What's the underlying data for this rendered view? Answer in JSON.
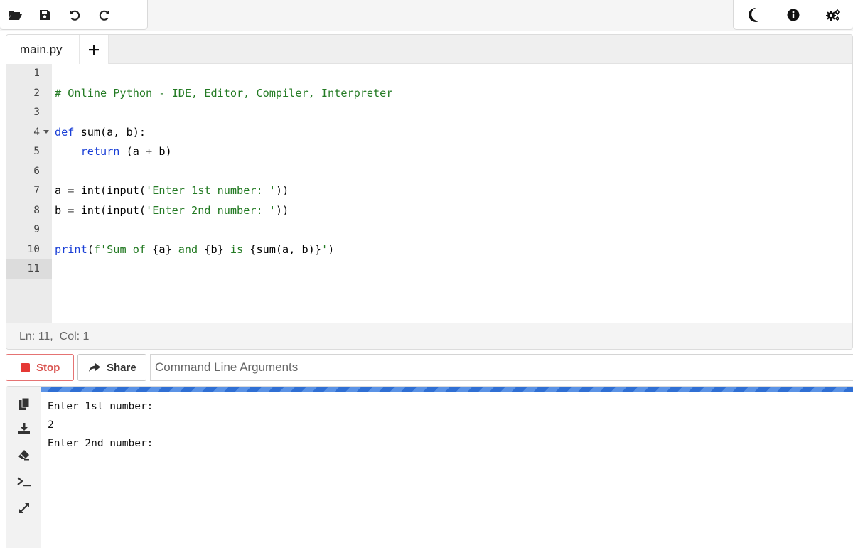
{
  "toolbar": {
    "left_icons": [
      "open-folder-icon",
      "save-icon",
      "undo-icon",
      "redo-icon"
    ],
    "right_icons": [
      "dark-mode-moon-icon",
      "info-icon",
      "settings-gears-icon"
    ]
  },
  "editor": {
    "tabs": [
      {
        "label": "main.py",
        "active": true
      }
    ],
    "add_tab_icon": "plus-icon",
    "line_numbers": [
      "1",
      "2",
      "3",
      "4",
      "5",
      "6",
      "7",
      "8",
      "9",
      "10",
      "11"
    ],
    "foldable_line": "4",
    "active_line": "11",
    "code_lines": [
      {
        "line": "1",
        "tokens": []
      },
      {
        "line": "2",
        "tokens": [
          {
            "t": "# Online Python - IDE, Editor, Compiler, Interpreter",
            "k": "comment"
          }
        ]
      },
      {
        "line": "3",
        "tokens": []
      },
      {
        "line": "4",
        "tokens": [
          {
            "t": "def",
            "k": "kw"
          },
          {
            "t": " sum(a, b):",
            "k": "plain"
          }
        ]
      },
      {
        "line": "5",
        "tokens": [
          {
            "t": "    ",
            "k": "plain"
          },
          {
            "t": "return",
            "k": "kw"
          },
          {
            "t": " (a ",
            "k": "plain"
          },
          {
            "t": "+",
            "k": "op"
          },
          {
            "t": " b)",
            "k": "plain"
          }
        ]
      },
      {
        "line": "6",
        "tokens": []
      },
      {
        "line": "7",
        "tokens": [
          {
            "t": "a ",
            "k": "plain"
          },
          {
            "t": "=",
            "k": "op"
          },
          {
            "t": " int(input(",
            "k": "plain"
          },
          {
            "t": "'Enter 1st number: '",
            "k": "str"
          },
          {
            "t": "))",
            "k": "plain"
          }
        ]
      },
      {
        "line": "8",
        "tokens": [
          {
            "t": "b ",
            "k": "plain"
          },
          {
            "t": "=",
            "k": "op"
          },
          {
            "t": " int(input(",
            "k": "plain"
          },
          {
            "t": "'Enter 2nd number: '",
            "k": "str"
          },
          {
            "t": "))",
            "k": "plain"
          }
        ]
      },
      {
        "line": "9",
        "tokens": []
      },
      {
        "line": "10",
        "tokens": [
          {
            "t": "print",
            "k": "kw"
          },
          {
            "t": "(",
            "k": "plain"
          },
          {
            "t": "f'Sum of ",
            "k": "str"
          },
          {
            "t": "{a}",
            "k": "plain"
          },
          {
            "t": " and ",
            "k": "str"
          },
          {
            "t": "{b}",
            "k": "plain"
          },
          {
            "t": " is ",
            "k": "str"
          },
          {
            "t": "{sum(a, b)}",
            "k": "plain"
          },
          {
            "t": "'",
            "k": "str"
          },
          {
            "t": ")",
            "k": "plain"
          }
        ]
      },
      {
        "line": "11",
        "tokens": []
      }
    ],
    "status": "Ln: 11,  Col: 1"
  },
  "run": {
    "stop_label": "Stop",
    "share_label": "Share",
    "args_placeholder": "Command Line Arguments",
    "args_value": ""
  },
  "console": {
    "sidebar_icons": [
      "copy-icon",
      "download-icon",
      "eraser-icon",
      "terminal-prompt-icon",
      "expand-arrows-icon"
    ],
    "output_lines": [
      "Enter 1st number:",
      "2",
      "Enter 2nd number:"
    ]
  },
  "colors": {
    "accent_blue": "#2f6fd4",
    "stop_red": "#e53935",
    "keyword": "#1a3fd6",
    "string": "#237a23",
    "gutter": "#ebebeb"
  }
}
